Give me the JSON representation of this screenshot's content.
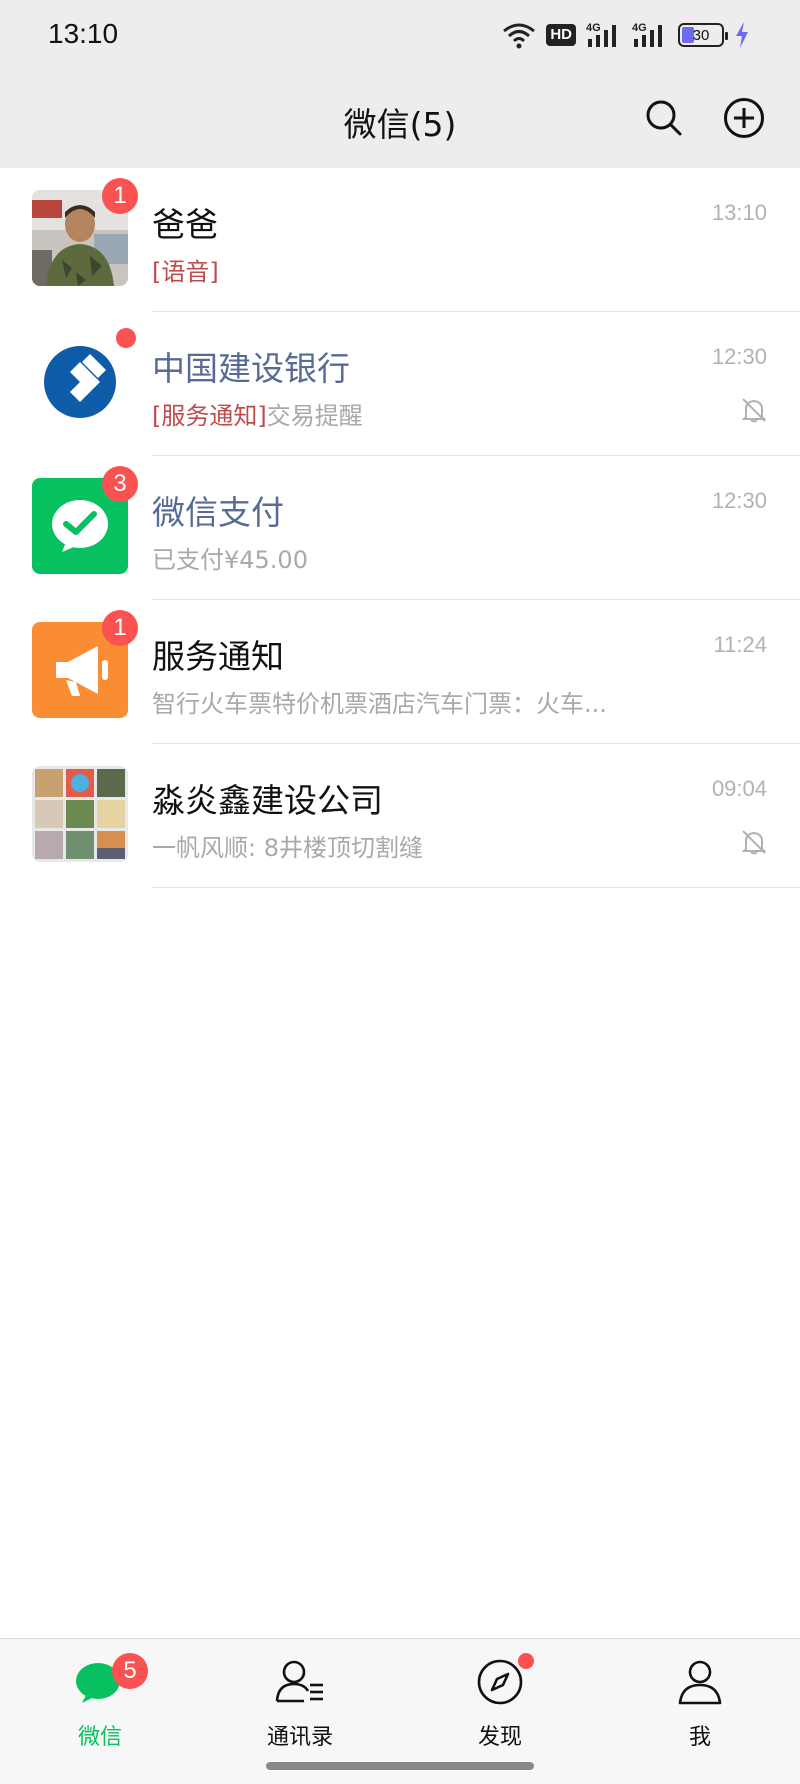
{
  "status_bar": {
    "time": "13:10",
    "hd_label": "HD",
    "network_label_1": "4G",
    "network_label_2": "4G",
    "battery_percent": "30",
    "battery_level": 0.3
  },
  "header": {
    "title": "微信(5)"
  },
  "colors": {
    "accent_green": "#07c160",
    "badge_red": "#fa5151",
    "header_bg": "#ededed",
    "official_name_blue": "#576b95",
    "tag_red": "#c04b4b"
  },
  "chats": [
    {
      "name": "爸爸",
      "preview_tag": "[语音]",
      "preview_text": "",
      "time": "13:10",
      "badge": "1",
      "muted": false
    },
    {
      "name": "中国建设银行",
      "preview_tag": "[服务通知]",
      "preview_text": "交易提醒",
      "time": "12:30",
      "badge_dot": true,
      "muted": true
    },
    {
      "name": "微信支付",
      "preview_tag": "",
      "preview_text": "已支付¥45.00",
      "time": "12:30",
      "badge": "3",
      "muted": false
    },
    {
      "name": "服务通知",
      "preview_tag": "",
      "preview_text": "智行火车票特价机票酒店汽车门票：火车...",
      "time": "11:24",
      "badge": "1",
      "muted": false
    },
    {
      "name": "淼炎鑫建设公司",
      "preview_tag": "",
      "preview_text": "一帆风顺: 8井楼顶切割缝",
      "time": "09:04",
      "muted": true
    }
  ],
  "tabs": [
    {
      "label": "微信",
      "badge": "5",
      "active": true
    },
    {
      "label": "通讯录"
    },
    {
      "label": "发现",
      "badge_dot": true
    },
    {
      "label": "我"
    }
  ]
}
